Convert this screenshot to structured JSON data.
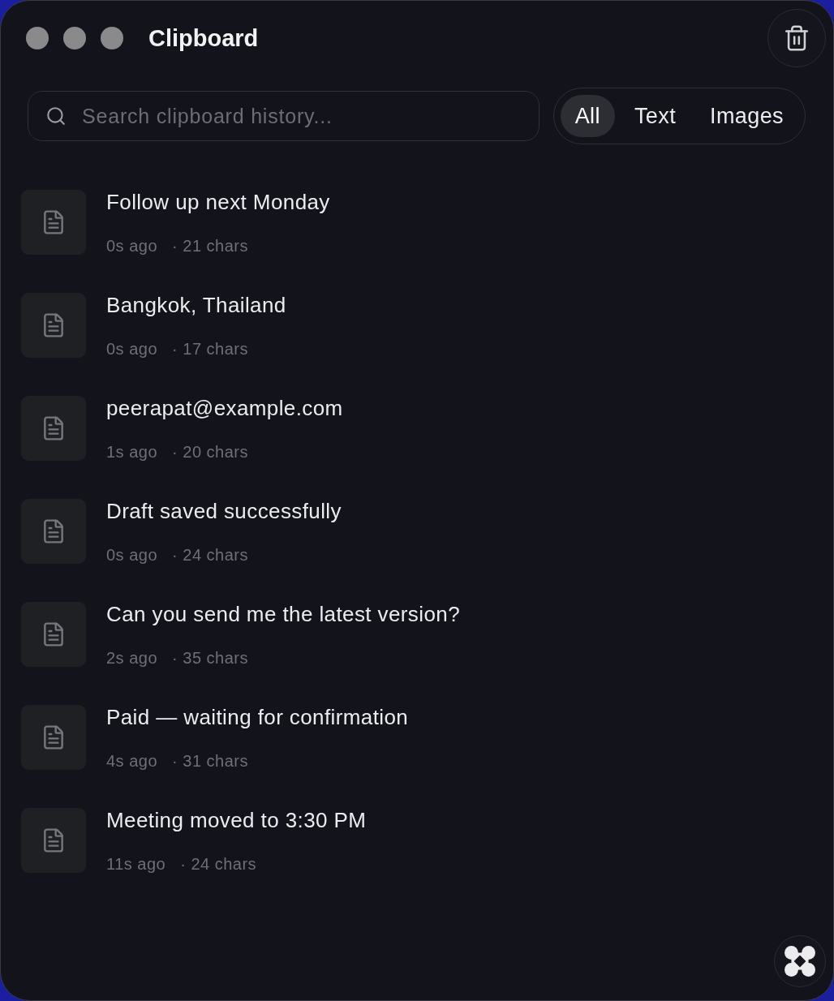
{
  "window": {
    "title": "Clipboard"
  },
  "search": {
    "placeholder": "Search clipboard history..."
  },
  "filters": [
    {
      "label": "All",
      "selected": true
    },
    {
      "label": "Text",
      "selected": false
    },
    {
      "label": "Images",
      "selected": false
    }
  ],
  "items": [
    {
      "text": "Follow up next Monday",
      "time": "0s ago",
      "size": "· 21 chars"
    },
    {
      "text": "Bangkok, Thailand",
      "time": "0s ago",
      "size": "· 17 chars"
    },
    {
      "text": "peerapat@example.com",
      "time": "1s ago",
      "size": "· 20 chars"
    },
    {
      "text": "Draft saved successfully",
      "time": "0s ago",
      "size": "· 24 chars"
    },
    {
      "text": "Can you send me the latest version?",
      "time": "2s ago",
      "size": "· 35 chars"
    },
    {
      "text": "Paid — waiting for confirmation",
      "time": "4s ago",
      "size": "· 31 chars"
    },
    {
      "text": "Meeting moved to 3:30 PM",
      "time": "11s ago",
      "size": "· 24 chars"
    }
  ]
}
